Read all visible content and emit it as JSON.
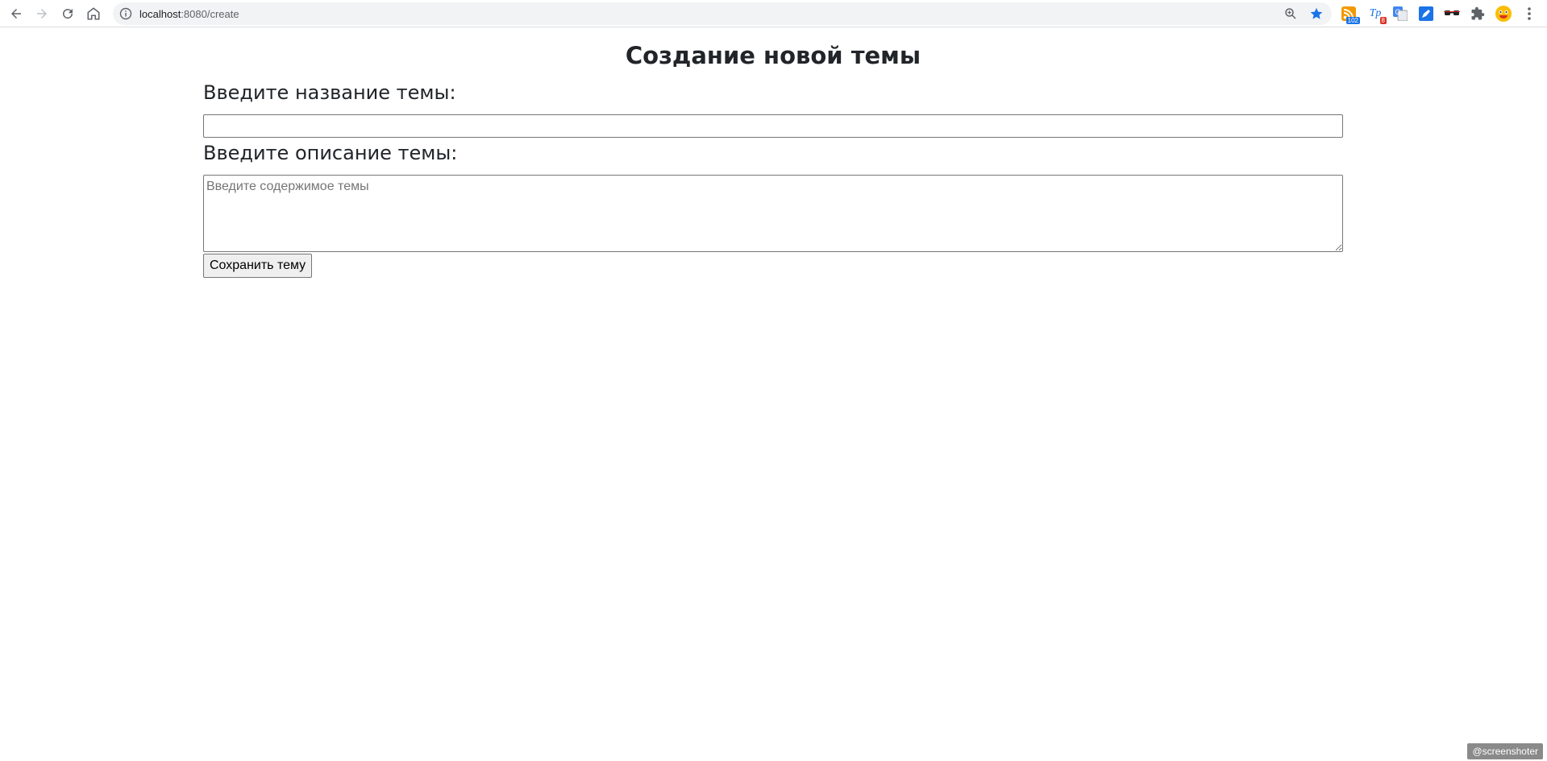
{
  "browser": {
    "url_host": "localhost",
    "url_path": ":8080/create",
    "extensions": [
      {
        "name": "rss-extension-icon",
        "badge": "102",
        "badge_color": "#1a73e8"
      },
      {
        "name": "translate-extension-icon",
        "badge": "8",
        "badge_color": "#d93025"
      },
      {
        "name": "google-translate-icon"
      },
      {
        "name": "pen-extension-icon"
      },
      {
        "name": "glasses-extension-icon"
      },
      {
        "name": "puzzle-icon"
      },
      {
        "name": "profile-avatar-icon"
      },
      {
        "name": "more-menu-icon"
      }
    ]
  },
  "page": {
    "title": "Создание новой темы",
    "name_label": "Введите название темы:",
    "name_value": "",
    "desc_label": "Введите описание темы:",
    "desc_placeholder": "Введите содержимое темы",
    "save_label": "Сохранить тему"
  },
  "watermark": "@screenshoter",
  "colors": {
    "accent_star": "#1a73e8",
    "text": "#212529"
  }
}
